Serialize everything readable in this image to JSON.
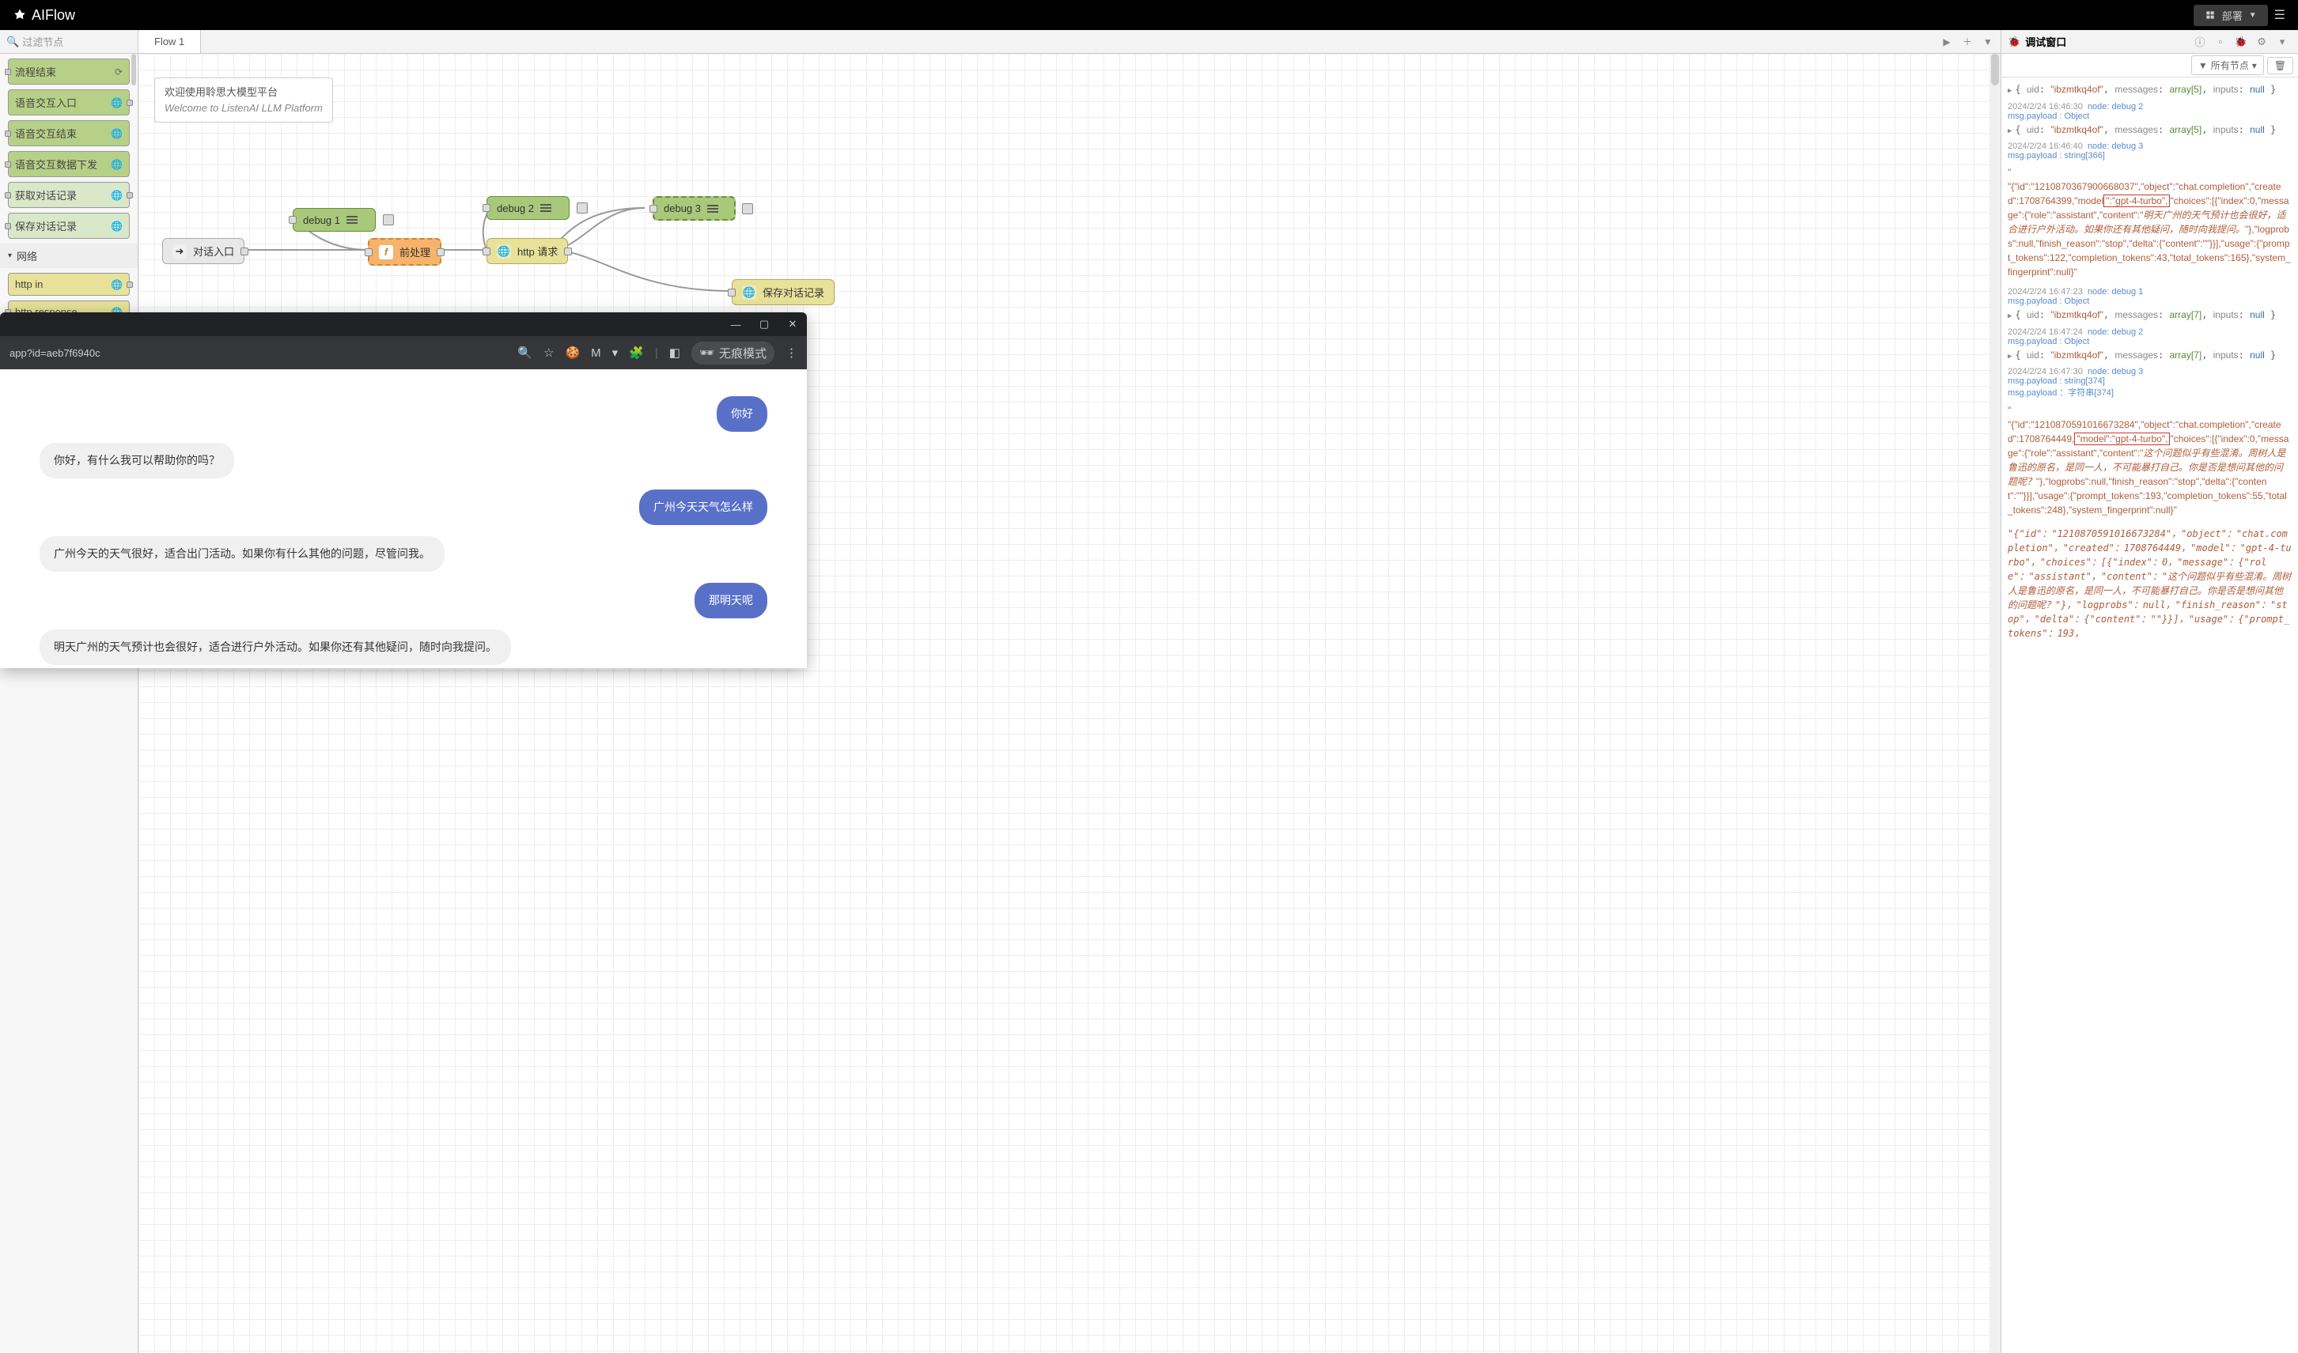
{
  "header": {
    "app_name": "AIFlow",
    "deploy_label": "部署"
  },
  "secondbar": {
    "filter_placeholder": "过滤节点",
    "tab_label": "Flow 1",
    "debug_title": "调试窗口"
  },
  "palette": {
    "nodes": [
      {
        "label": "流程结束",
        "has_refresh": true
      },
      {
        "label": "语音交互入口"
      },
      {
        "label": "语音交互结束"
      },
      {
        "label": "语音交互数据下发"
      },
      {
        "label": "获取对话记录"
      },
      {
        "label": "保存对话记录"
      }
    ],
    "cat_network": "网络",
    "http_in": "http in",
    "http_response": "http response"
  },
  "canvas": {
    "comment_l1": "欢迎使用聆思大模型平台",
    "comment_l2": "Welcome to ListenAI LLM Platform",
    "node_dialog_entry": "对话入口",
    "node_preprocess": "前处理",
    "node_http": "http 请求",
    "node_debug1": "debug 1",
    "node_debug2": "debug 2",
    "node_debug3": "debug 3",
    "node_save_conv": "保存对话记录"
  },
  "debug_toolbar": {
    "all_nodes": "所有节点"
  },
  "debug": {
    "uid_label": "uid",
    "messages_label": "messages",
    "inputs_label": "inputs",
    "uid_val": "\"ibzmtkq4of\"",
    "arr5": "array[5]",
    "arr7": "array[7]",
    "null_val": "null",
    "ts1": "2024/2/24 16:46:30",
    "ts2": "2024/2/24 16:46:40",
    "ts3": "2024/2/24 16:47:23",
    "ts4": "2024/2/24 16:47:24",
    "ts5": "2024/2/24 16:47:30",
    "node_d1": "node: debug 1",
    "node_d2": "node: debug 2",
    "node_d3": "node: debug 3",
    "msg_obj": "msg.payload : Object",
    "msg_str366": "msg.payload : string[366]",
    "msg_str374": "msg.payload : string[374]",
    "msg_str374_cn": "msg.payload ：字符串[374]",
    "body1_a": "\"{\"id\":\"1210870367900668037\",\"object\":\"chat.completion\",\"created\":1708764399,\"model",
    "body1_hl": "\":\"gpt-4-turbo\",",
    "body1_b": "\"choices\":[{\"index\":0,\"message\":{\"role\":\"assistant\",\"content\":\"",
    "body1_cn": "明天广州的天气预计也会很好，适合进行户外活动。如果你还有其他疑问，随时向我提问。",
    "body1_c": "\"},\"logprobs\":null,\"finish_reason\":\"stop\",\"delta\":{\"content\":\"\"}}],\"usage\":{\"prompt_tokens\":122,\"completion_tokens\":43,\"total_tokens\":165},\"system_fingerprint\":null}\"",
    "body2_a": "\"{\"id\":\"1210870591016673284\",\"object\":\"chat.completion\",\"created\":1708764449,",
    "body2_hl": "\"model\":\"gpt-4-turbo\",",
    "body2_b": "\"choices\":[{\"index\":0,\"message\":{\"role\":\"assistant\",\"content\":\"",
    "body2_cn": "这个问题似乎有些混淆。周树人是鲁迅的原名，是同一人，不可能暴打自己。你是否是想问其他的问题呢？",
    "body2_c": "\"},\"logprobs\":null,\"finish_reason\":\"stop\",\"delta\":{\"content\":\"\"}}],\"usage\":{\"prompt_tokens\":193,\"completion_tokens\":55,\"total_tokens\":248},\"system_fingerprint\":null}\"",
    "body3": "\"{\"id\"：\"1210870591016673284\"，\"object\"：\"chat.completion\"，\"created\"：1708764449，\"model\"：\"gpt-4-turbo\"，\"choices\"：[{\"index\"：0，\"message\"：{\"role\"：\"assistant\"，\"content\"：\"这个问题似乎有些混淆。周树人是鲁迅的原名，是同一人，不可能暴打自己。你是否是想问其他的问题呢？\"}，\"logprobs\"：null，\"finish_reason\"：\"stop\"，\"delta\"：{\"content\"：\"\"}}]，\"usage\"：{\"prompt_tokens\"：193，"
  },
  "browser": {
    "url": "app?id=aeb7f6940c",
    "incognito": "无痕模式"
  },
  "chat": {
    "m1": "你好",
    "m2": "你好，有什么我可以帮助你的吗？",
    "m3": "广州今天天气怎么样",
    "m4": "广州今天的天气很好，适合出门活动。如果你有什么其他的问题，尽管问我。",
    "m5": "那明天呢",
    "m6": "明天广州的天气预计也会很好，适合进行户外活动。如果你还有其他疑问，随时向我提问。"
  }
}
